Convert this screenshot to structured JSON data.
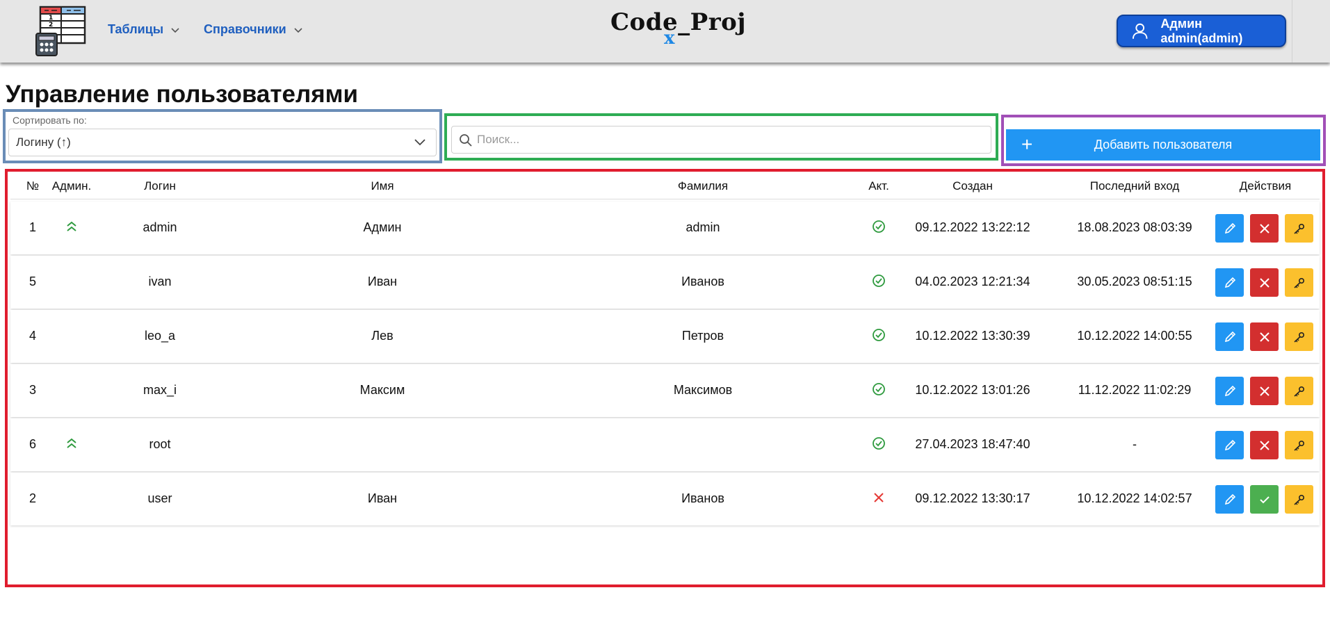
{
  "header": {
    "nav": [
      {
        "label": "Таблицы"
      },
      {
        "label": "Справочники"
      }
    ],
    "brand": "Code_Proj",
    "brand_sub": "x",
    "user_label": "Админ admin(admin)"
  },
  "page": {
    "title": "Управление пользователями"
  },
  "controls": {
    "sort_label": "Сортировать по:",
    "sort_value": "Логину (↑)",
    "search_placeholder": "Поиск...",
    "search_value": "",
    "add_label": "Добавить пользователя"
  },
  "table": {
    "columns": [
      "№",
      "Админ.",
      "Логин",
      "Имя",
      "Фамилия",
      "Акт.",
      "Создан",
      "Последний вход",
      "Действия"
    ],
    "rows": [
      {
        "id": "1",
        "admin": true,
        "login": "admin",
        "name": "Админ",
        "surname": "admin",
        "active": true,
        "created": "09.12.2022 13:22:12",
        "last_login": "18.08.2023 08:03:39"
      },
      {
        "id": "5",
        "admin": false,
        "login": "ivan",
        "name": "Иван",
        "surname": "Иванов",
        "active": true,
        "created": "04.02.2023 12:21:34",
        "last_login": "30.05.2023 08:51:15"
      },
      {
        "id": "4",
        "admin": false,
        "login": "leo_a",
        "name": "Лев",
        "surname": "Петров",
        "active": true,
        "created": "10.12.2022 13:30:39",
        "last_login": "10.12.2022 14:00:55"
      },
      {
        "id": "3",
        "admin": false,
        "login": "max_i",
        "name": "Максим",
        "surname": "Максимов",
        "active": true,
        "created": "10.12.2022 13:01:26",
        "last_login": "11.12.2022 11:02:29"
      },
      {
        "id": "6",
        "admin": true,
        "login": "root",
        "name": "",
        "surname": "",
        "active": true,
        "created": "27.04.2023 18:47:40",
        "last_login": "-"
      },
      {
        "id": "2",
        "admin": false,
        "login": "user",
        "name": "Иван",
        "surname": "Иванов",
        "active": false,
        "created": "09.12.2022 13:30:17",
        "last_login": "10.12.2022 14:02:57"
      }
    ]
  },
  "icons": {
    "admin": "double-chevron-up-icon",
    "active": "check-circle-icon",
    "inactive": "x-icon",
    "edit": "pencil-icon",
    "delete": "close-icon",
    "activate": "check-icon",
    "password": "key-icon"
  },
  "colors": {
    "nav_text": "#1f5fbf",
    "user_button": "#1a5fd6",
    "primary": "#2196f3",
    "danger": "#d32f2f",
    "success": "#4caf50",
    "warning": "#fbc02d",
    "active_green": "#2e9a3e",
    "inactive_red": "#e53935"
  }
}
